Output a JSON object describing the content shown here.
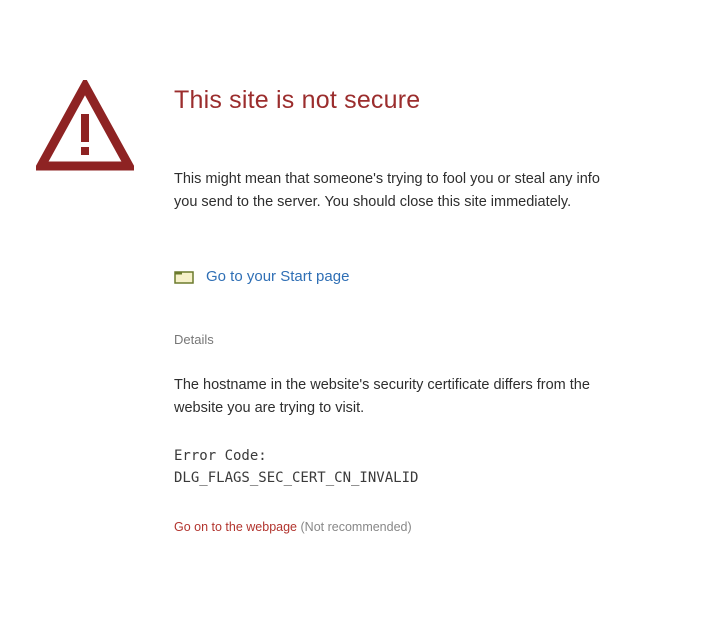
{
  "page": {
    "title": "This site is not secure",
    "description": "This might mean that someone's trying to fool you or steal any info you send to the server. You should close this site immediately.",
    "start_link": "Go to your Start page",
    "details_label": "Details",
    "details_text": "The hostname in the website's security certificate differs from the website you are trying to visit.",
    "error_code_label": "Error Code:",
    "error_code_value": "DLG_FLAGS_SEC_CERT_CN_INVALID",
    "proceed_link": "Go on to the webpage",
    "proceed_note": "(Not recommended)"
  },
  "icons": {
    "warning": "warning-triangle-icon",
    "start_page": "folder-icon"
  },
  "colors": {
    "title": "#9b2d2d",
    "warning_icon": "#8e2323",
    "link": "#2f6fb5",
    "proceed_link": "#b2342e"
  }
}
